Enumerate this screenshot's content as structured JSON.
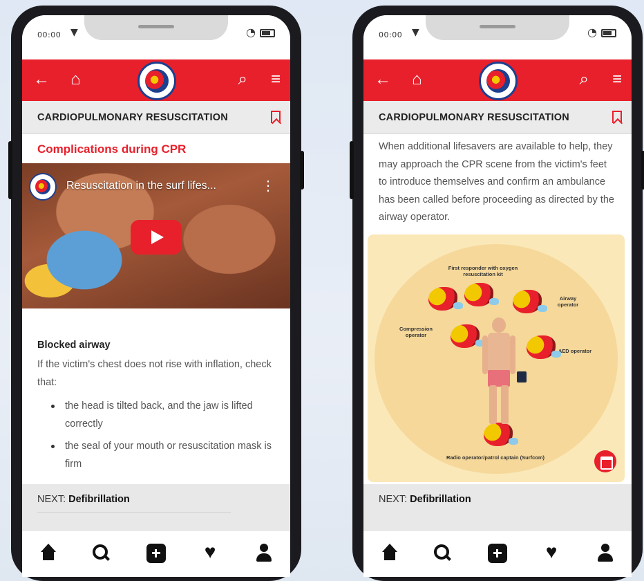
{
  "status": {
    "time": "00:00",
    "network": "▼"
  },
  "header": {
    "title": "CARDIOPULMONARY RESUSCITATION"
  },
  "left": {
    "section_heading": "Complications during CPR",
    "video": {
      "title": "Resuscitation in the surf lifes..."
    },
    "article": {
      "subheading": "Blocked airway",
      "intro": "If the victim's chest does not rise with inflation, check that:",
      "bullets": [
        "the head is tilted back, and the jaw is lifted correctly",
        "the seal of your mouth or resuscitation mask is firm"
      ]
    },
    "next": {
      "prefix": "NEXT: ",
      "label": "Defibrillation"
    }
  },
  "right": {
    "paragraph": "When additional lifesavers are available to help, they may approach the CPR scene from the victim's feet to introduce themselves and confirm an ambulance has been called before proceeding as directed by the airway operator.",
    "illustration_labels": {
      "first_responder": "First responder with oxygen resuscitation kit",
      "airway": "Airway operator",
      "compression": "Compression operator",
      "aed": "AED operator",
      "radio": "Radio operator/patrol captain (Surfcom)"
    },
    "next": {
      "prefix": "NEXT: ",
      "label": "Defibrillation"
    }
  },
  "colors": {
    "brand_red": "#e8202b",
    "navy": "#1d3f8f",
    "sand": "#fbe8b8"
  },
  "icons": {
    "appbar": [
      "back-arrow-icon",
      "home-icon",
      "logo",
      "search-icon",
      "menu-icon"
    ],
    "bottom_nav": [
      "home-icon",
      "search-icon",
      "add-icon",
      "heart-icon",
      "profile-icon"
    ]
  }
}
